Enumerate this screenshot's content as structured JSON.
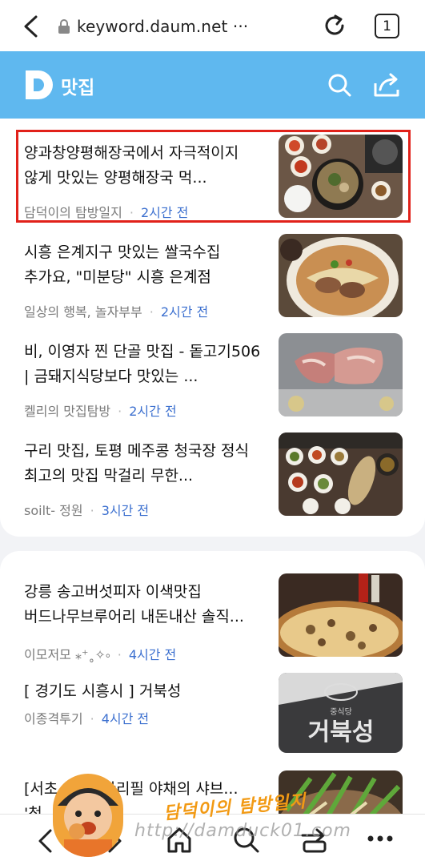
{
  "browser": {
    "url": "keyword.daum.net ···",
    "tab_count": "1",
    "icons": [
      "back-arrow-icon",
      "lock-icon",
      "reload-icon",
      "tab-count-box"
    ]
  },
  "header": {
    "logo_letter": "D",
    "title": "맛집",
    "bg_color": "#5fb8ef",
    "icons": [
      "search-icon",
      "share-icon"
    ]
  },
  "articles": [
    {
      "title": "양과창양평해장국에서 자극적이지 않게 맛있는 양평해장국 먹...",
      "source": "담덕이의 탐방일지",
      "time": "2시간 전",
      "highlighted": true
    },
    {
      "title": "시흥 은계지구 맛있는 쌀국수집 추가요, \"미분당\" 시흥 은계점",
      "source": "일상의 행복, 놀자부부",
      "time": "2시간 전"
    },
    {
      "title": "비, 이영자 찐 단골 맛집 - 돝고기506 | 금돼지식당보다 맛있는 ...",
      "source": "켈리의 맛집탐방",
      "time": "2시간 전"
    },
    {
      "title": "구리 맛집, 토평 메주콩 청국장 정식 최고의 맛집 막걸리 무한...",
      "source": "soilt- 정원",
      "time": "3시간 전"
    },
    {
      "title": "강릉 송고버섯피자 이색맛집 버드나무브루어리 내돈내산 솔직...",
      "source": "이모저모 ⁎⁺˳✧༚",
      "time": "4시간 전"
    },
    {
      "title": "[ 경기도 시흥시 ] 거북성",
      "source": "이종격투기",
      "time": "4시간 전",
      "thumb_text": "거북성",
      "thumb_small": "중식당"
    },
    {
      "title": "[서초... ] 무한리필 야채의 샤브... '청...",
      "source": "",
      "time": ""
    }
  ],
  "bottom_nav": {
    "icons": [
      "back-icon",
      "forward-icon",
      "home-icon",
      "search-icon",
      "tabs-icon",
      "more-icon"
    ]
  },
  "watermark": {
    "name": "담덕이의 탐방일지",
    "url": "http://damduck01.com"
  },
  "colors": {
    "highlight_border": "#e1211a",
    "time_text": "#3b6fcf",
    "meta_text": "#7a7a7a"
  }
}
